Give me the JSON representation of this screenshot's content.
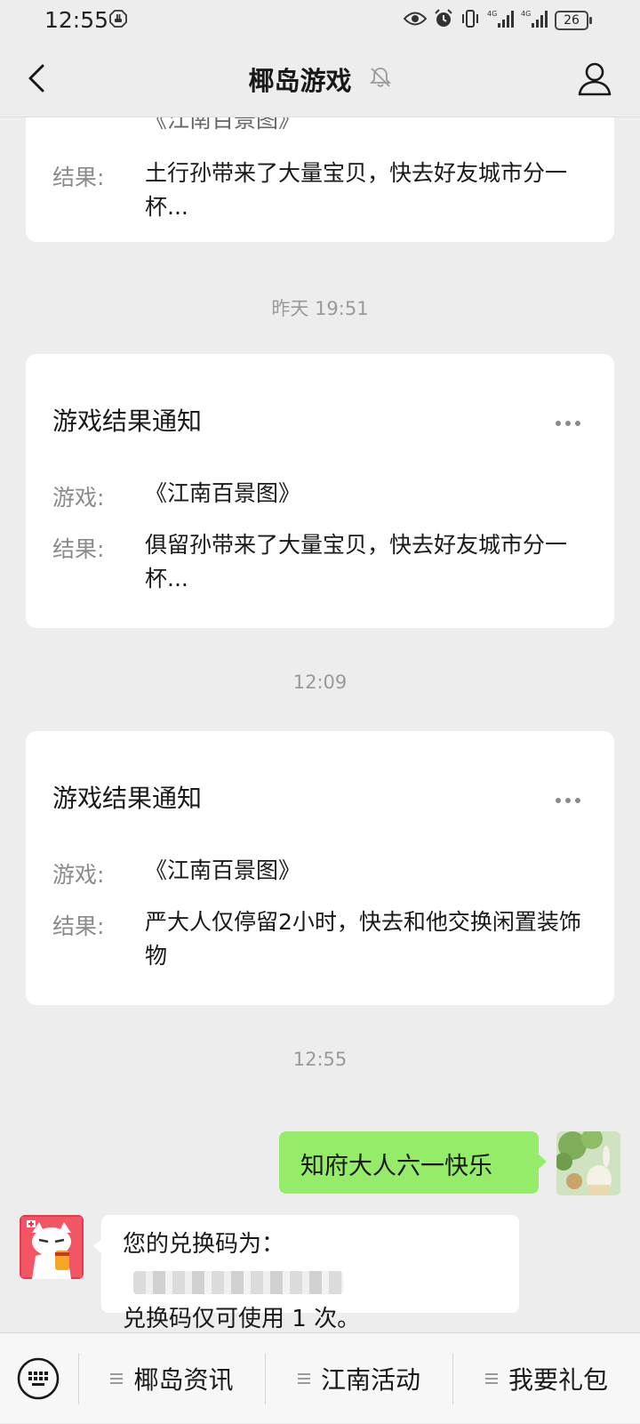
{
  "status_bar": {
    "time": "12:55",
    "battery_level": "26",
    "network": "4G"
  },
  "nav": {
    "title": "椰岛游戏"
  },
  "chat": {
    "partial_card": {
      "game_value": "《江南百景图》",
      "result_label": "结果:",
      "result_value": "土行孙带来了大量宝贝，快去好友城市分一杯..."
    },
    "timestamps": [
      "昨天 19:51",
      "12:09",
      "12:55"
    ],
    "cards": [
      {
        "title": "游戏结果通知",
        "game_label": "游戏:",
        "game_value": "《江南百景图》",
        "result_label": "结果:",
        "result_value": "俱留孙带来了大量宝贝，快去好友城市分一杯..."
      },
      {
        "title": "游戏结果通知",
        "game_label": "游戏:",
        "game_value": "《江南百景图》",
        "result_label": "结果:",
        "result_value": "严大人仅停留2小时，快去和他交换闲置装饰物"
      }
    ],
    "sent_message": "知府大人六一快乐",
    "received_message": {
      "line1": "您的兑换码为：",
      "line2": "兑换码仅可使用 1 次。"
    }
  },
  "menu": {
    "items": [
      "椰岛资讯",
      "江南活动",
      "我要礼包"
    ]
  },
  "colors": {
    "background": "#ededed",
    "sent_bubble": "#95ec69",
    "card": "#ffffff",
    "secondary_text": "#8b8b8b"
  }
}
